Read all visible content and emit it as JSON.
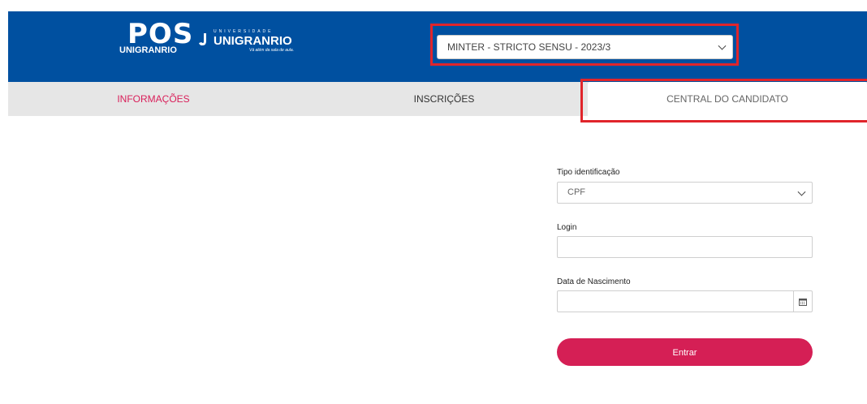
{
  "header": {
    "logo_pos_text": "POS",
    "logo_pos_sub": "UNIGRANRIO",
    "logo_uni_small": "UNIVERSIDADE",
    "logo_uni_big": "UNIGRANRIO",
    "logo_uni_slogan": "Vá além da sala de aula.",
    "program_select": {
      "selected": "MINTER - STRICTO SENSU - 2023/3"
    }
  },
  "nav": {
    "tabs": [
      {
        "label": "INFORMAÇÕES"
      },
      {
        "label": "INSCRIÇÕES"
      },
      {
        "label": "CENTRAL DO CANDIDATO"
      }
    ]
  },
  "form": {
    "tipo_label": "Tipo identificação",
    "tipo_value": "CPF",
    "login_label": "Login",
    "login_value": "",
    "nascimento_label": "Data de Nascimento",
    "nascimento_value": "",
    "submit_label": "Entrar"
  },
  "colors": {
    "header_bg": "#0050a0",
    "accent": "#d51f55",
    "highlight_box": "#e0252b",
    "nav_bg": "#e6e6e6"
  }
}
